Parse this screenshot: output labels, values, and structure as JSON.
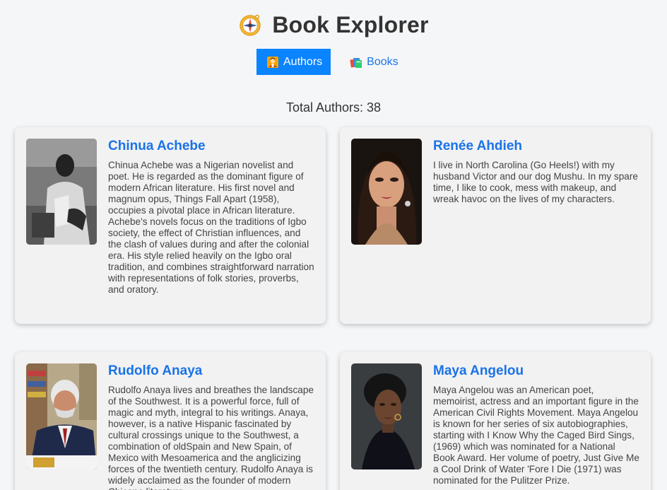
{
  "header": {
    "title": "Book Explorer",
    "logo_icon": "compass-icon"
  },
  "tabs": [
    {
      "label": "Authors",
      "icon": "authors-icon",
      "active": true
    },
    {
      "label": "Books",
      "icon": "books-icon",
      "active": false
    }
  ],
  "summary": {
    "total_authors": "Total Authors: 38"
  },
  "authors": [
    {
      "name": "Chinua Achebe",
      "bio": "Chinua Achebe was a Nigerian novelist and poet. He is regarded as the dominant figure of modern African literature. His first novel and magnum opus, Things Fall Apart (1958), occupies a pivotal place in African literature. Achebe's novels focus on the traditions of Igbo society, the effect of Christian influences, and the clash of values during and after the colonial era. His style relied heavily on the Igbo oral tradition, and combines straightforward narration with representations of folk stories, proverbs, and oratory."
    },
    {
      "name": "Renée Ahdieh",
      "bio": "I live in North Carolina (Go Heels!) with my husband Victor and our dog Mushu. In my spare time, I like to cook, mess with makeup, and wreak havoc on the lives of my characters."
    },
    {
      "name": "Rudolfo Anaya",
      "bio": "Rudolfo Anaya lives and breathes the landscape of the Southwest. It is a powerful force, full of magic and myth, integral to his writings. Anaya, however, is a native Hispanic fascinated by cultural crossings unique to the Southwest, a combination of oldSpain and New Spain, of Mexico with Mesoamerica and the anglicizing forces of the twentieth century. Rudolfo Anaya is widely acclaimed as the founder of modern Chicano literature."
    },
    {
      "name": "Maya Angelou",
      "bio": "Maya Angelou was an American poet, memoirist, actress and an important figure in the American Civil Rights Movement. Maya Angelou is known for her series of six autobiographies, starting with I Know Why the Caged Bird Sings, (1969) which was nominated for a National Book Award. Her volume of poetry, Just Give Me a Cool Drink of Water 'Fore I Die (1971) was nominated for the Pulitzer Prize."
    }
  ],
  "colors": {
    "accent": "#0a84ff",
    "link": "#1a73e8",
    "background": "#f5f6f8",
    "card": "#f2f2f2"
  }
}
